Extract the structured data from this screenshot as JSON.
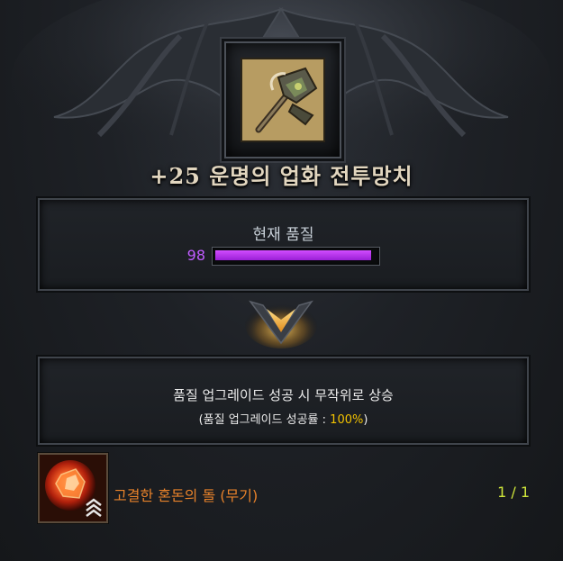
{
  "item": {
    "name": "+25 운명의 업화 전투망치",
    "icon": "warhammer-icon"
  },
  "quality_panel": {
    "title": "현재 품질",
    "value": "98",
    "level": 0.98,
    "bar_color": "#b43cff"
  },
  "info_panel": {
    "line1": "품질 업그레이드 성공 시 무작위로 상승",
    "line2_prefix": "(품질 업그레이드 성공률 : ",
    "line2_rate": "100%",
    "line2_suffix": ")"
  },
  "material": {
    "icon": "chaos-stone-icon",
    "name": "고결한 혼돈의 돌 (무기)",
    "count": "1 / 1",
    "name_color": "#e8822a",
    "count_color": "#cfe63a"
  }
}
